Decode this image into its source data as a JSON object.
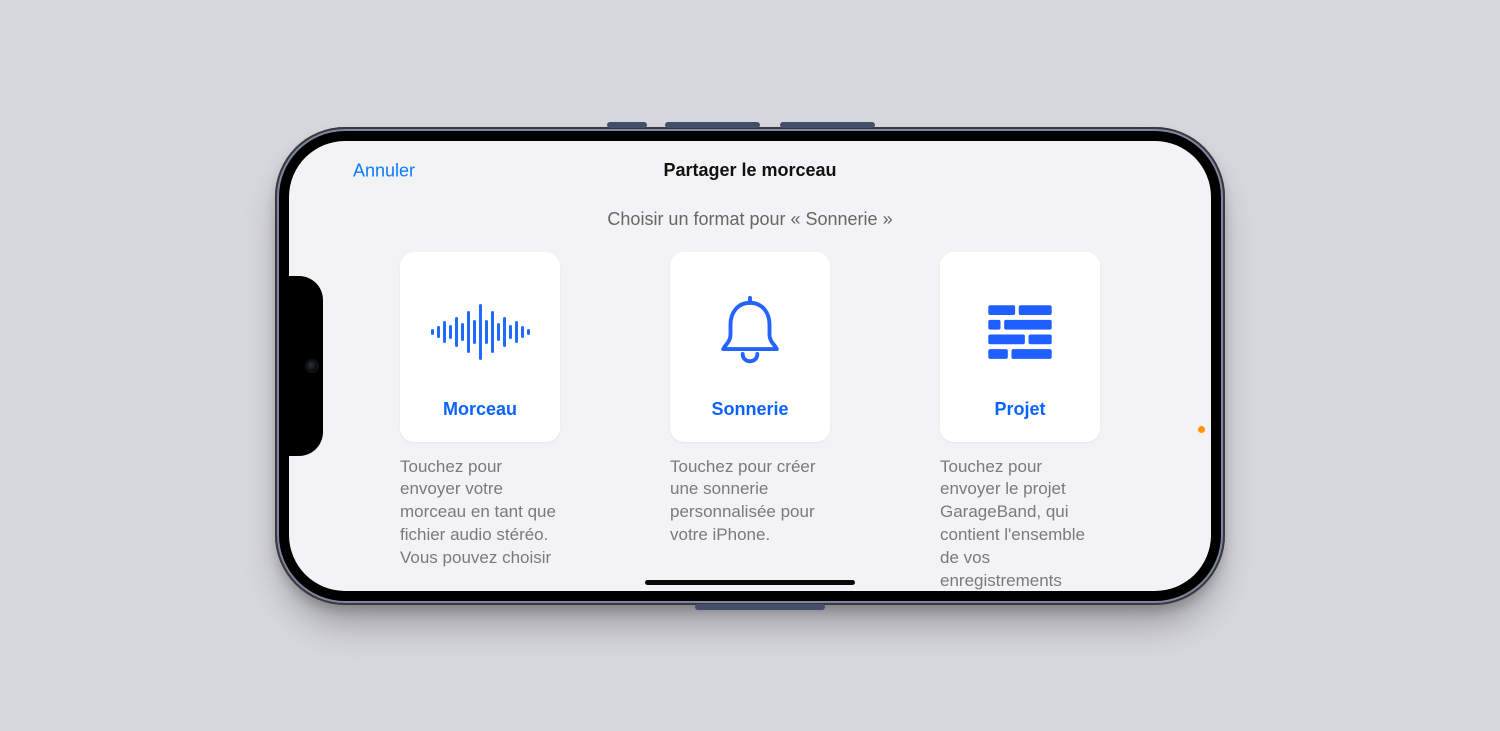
{
  "colors": {
    "accent": "#0a7aff",
    "iconBlue": "#1f6bff",
    "textMuted": "#7a7a7e",
    "bg": "#f3f3f5"
  },
  "nav": {
    "cancel": "Annuler",
    "title": "Partager le morceau"
  },
  "subtitle": "Choisir un format pour « Sonnerie »",
  "options": {
    "song": {
      "label": "Morceau",
      "desc": "Touchez pour envoyer votre morceau en tant que fichier audio stéréo. Vous pouvez choisir"
    },
    "ringtone": {
      "label": "Sonnerie",
      "desc": "Touchez pour créer une sonnerie personnalisée pour votre iPhone."
    },
    "project": {
      "label": "Projet",
      "desc": "Touchez pour envoyer le projet GarageBand, qui contient l'ensemble de vos enregistrements"
    }
  }
}
